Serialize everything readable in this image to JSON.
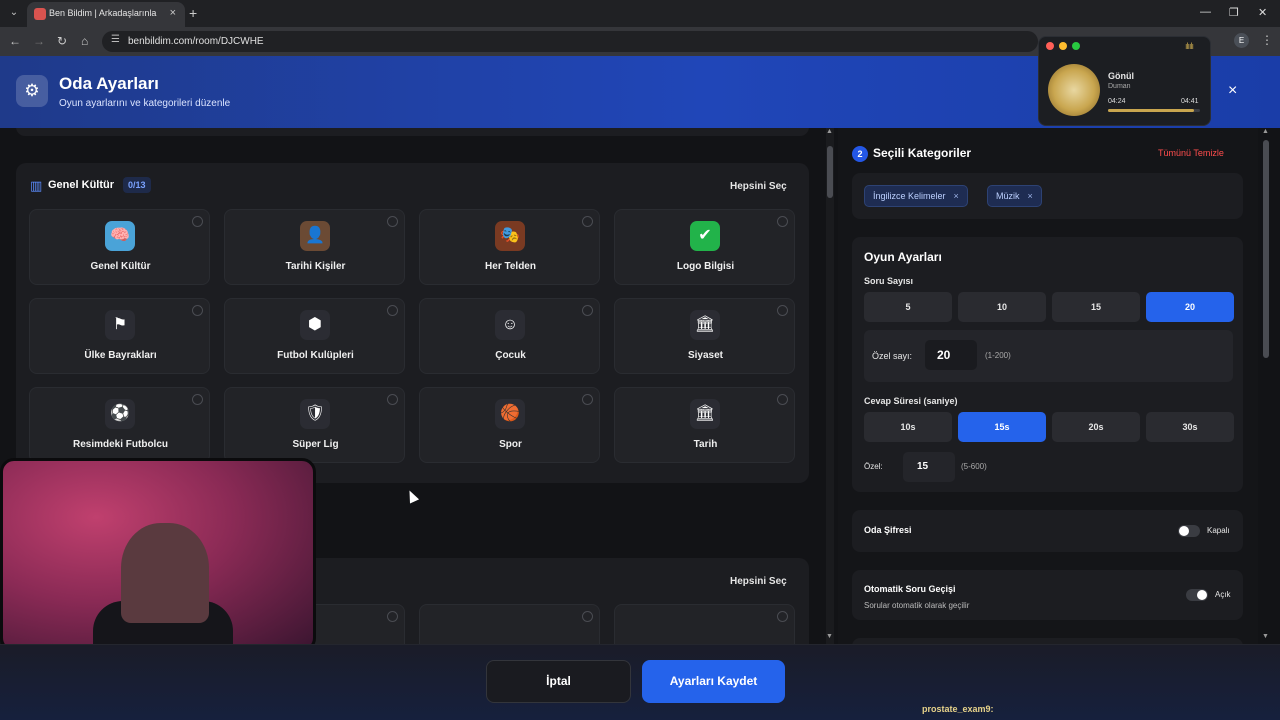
{
  "browser": {
    "tab_title": "Ben Bildim | Arkadaşlarınla Onli",
    "tab_close": "×",
    "new_tab": "+",
    "url": "benbildim.com/room/DJCWHE",
    "profile_initial": "E"
  },
  "header": {
    "title": "Oda Ayarları",
    "subtitle": "Oyun ayarlarını ve kategorileri düzenle",
    "close": "×",
    "icon": "gear-icon"
  },
  "music_player": {
    "song": "Gönül",
    "artist": "Duman",
    "elapsed": "04:24",
    "total": "04:41",
    "progress": 0.94,
    "bars": "ılıılı"
  },
  "category_group": {
    "title": "Genel Kültür",
    "count": "0/13",
    "select_all": "Hepsini Seç",
    "cards": [
      {
        "label": "Genel Kültür",
        "icon": "brain-icon",
        "color": "#4aa3d8",
        "glyph": "🧠"
      },
      {
        "label": "Tarihi Kişiler",
        "icon": "portrait-icon",
        "color": "#6b4a34",
        "glyph": "👤"
      },
      {
        "label": "Her Telden",
        "icon": "mixed-icon",
        "color": "#7a3a22",
        "glyph": "🎭"
      },
      {
        "label": "Logo Bilgisi",
        "icon": "logo-icon",
        "color": "#22b34a",
        "glyph": "✔"
      },
      {
        "label": "Ülke Bayrakları",
        "icon": "flag-icon",
        "color": "#2b2c33",
        "glyph": "⚑"
      },
      {
        "label": "Futbol Kulüpleri",
        "icon": "wolf-crest-icon",
        "color": "#2b2c33",
        "glyph": "⬢"
      },
      {
        "label": "Çocuk",
        "icon": "child-icon",
        "color": "#2b2c33",
        "glyph": "☺"
      },
      {
        "label": "Siyaset",
        "icon": "parliament-icon",
        "color": "#2b2c33",
        "glyph": "🏛"
      },
      {
        "label": "Resimdeki Futbolcu",
        "icon": "footballer-icon",
        "color": "#2b2c33",
        "glyph": "⚽"
      },
      {
        "label": "Süper Lig",
        "icon": "league-icon",
        "color": "#2b2c33",
        "glyph": "🛡"
      },
      {
        "label": "Spor",
        "icon": "sports-ball-icon",
        "color": "#2b2c33",
        "glyph": "🏀"
      },
      {
        "label": "Tarih",
        "icon": "colosseum-icon",
        "color": "#2b2c33",
        "glyph": "🏛"
      }
    ]
  },
  "lower_group": {
    "select_all": "Hepsini Seç"
  },
  "selected_categories": {
    "number": "2",
    "title": "Seçili Kategoriler",
    "clear_all": "Tümünü Temizle",
    "chips": [
      "İngilizce Kelimeler",
      "Müzik"
    ],
    "chip_remove": "×"
  },
  "game_settings": {
    "title": "Oyun Ayarları",
    "question_count_label": "Soru Sayısı",
    "question_options": [
      "5",
      "10",
      "15",
      "20"
    ],
    "question_selected": 3,
    "custom_count_label": "Özel sayı:",
    "custom_count_value": "20",
    "custom_count_range": "(1-200)",
    "answer_time_label": "Cevap Süresi (saniye)",
    "time_options": [
      "10s",
      "15s",
      "20s",
      "30s"
    ],
    "time_selected": 1,
    "custom_time_label": "Özel:",
    "custom_time_value": "15",
    "custom_time_range": "(5-600)"
  },
  "room_password": {
    "label": "Oda Şifresi",
    "state": "Kapalı",
    "on": false
  },
  "auto_next": {
    "label": "Otomatik Soru Geçişi",
    "description": "Sorular otomatik olarak geçilir",
    "state": "Açık",
    "on": true
  },
  "footer": {
    "cancel": "İptal",
    "save": "Ayarları Kaydet",
    "chat_user": "prostate_exam9:"
  }
}
